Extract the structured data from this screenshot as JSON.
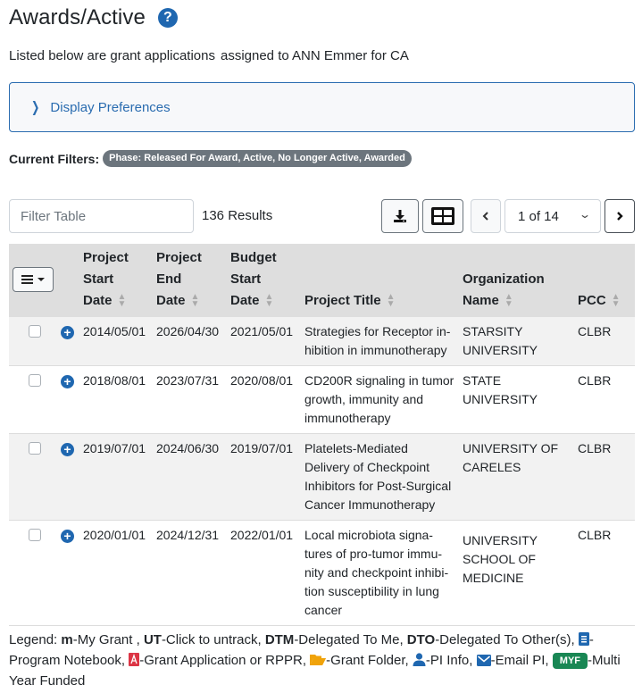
{
  "header": {
    "title": "Awards/Active",
    "help_icon": "question-circle-icon",
    "subtitle_prefix": "Listed below are grant applications",
    "subtitle_suffix": "assigned to ANN Emmer for CA"
  },
  "display_preferences": {
    "label": "Display Preferences",
    "icon": "chevron-right-icon",
    "expanded": false
  },
  "filters": {
    "label": "Current Filters:",
    "badges": [
      "Phase: Released For Award, Active, No Longer Active, Awarded"
    ]
  },
  "toolbar": {
    "filter_placeholder": "Filter Table",
    "filter_value": "",
    "results_count": "136 Results",
    "download_icon": "download-icon",
    "columns_icon": "table-columns-icon",
    "prev_icon": "chevron-left-icon",
    "next_icon": "chevron-right-icon",
    "page_select": "1 of 14"
  },
  "table": {
    "menu_icon": "hamburger-menu-icon",
    "columns": [
      {
        "key": "start",
        "label_lines": [
          "Project",
          "Start",
          "Date"
        ],
        "sortable": true
      },
      {
        "key": "end",
        "label_lines": [
          "Project",
          "End",
          "Date"
        ],
        "sortable": true
      },
      {
        "key": "budget",
        "label_lines": [
          "Budget",
          "Start",
          "Date"
        ],
        "sortable": true
      },
      {
        "key": "title",
        "label_lines": [
          "Project Title"
        ],
        "sortable": true
      },
      {
        "key": "org",
        "label_lines": [
          "Organization",
          "Name"
        ],
        "sortable": true
      },
      {
        "key": "pcc",
        "label_lines": [
          "PCC"
        ],
        "sortable": true
      }
    ],
    "rows": [
      {
        "checked": false,
        "start": "2014/05/01",
        "end": "2026/04/30",
        "budget": "2021/05/01",
        "title": "Strategies for Receptor in­hibition in immunotherapy",
        "org": "STARSITY UNIVERSITY",
        "pcc": "CLBR"
      },
      {
        "checked": false,
        "start": "2018/08/01",
        "end": "2023/07/31",
        "budget": "2020/08/01",
        "title": "CD200R signaling in tumor growth, immunity and immunotherapy",
        "org": "STATE UNIVERSITY",
        "pcc": "CLBR"
      },
      {
        "checked": false,
        "start": "2019/07/01",
        "end": "2024/06/30",
        "budget": "2019/07/01",
        "title": "Platelets-Mediated Delivery of Checkpoint Inhibitors for Post-Surgical Cancer Immunotherapy",
        "org": "UNIVERSITY OF CARELES",
        "pcc": "CLBR"
      },
      {
        "checked": false,
        "start": "2020/01/01",
        "end": "2024/12/31",
        "budget": "2022/01/01",
        "title": "Local microbiota signa­tures of pro-tumor immu­nity and checkpoint inhibi­tion susceptibility in lung cancer",
        "org": "UNIVERSITY SCHOOL OF MEDICINE",
        "pcc": "CLBR"
      }
    ]
  },
  "legend": {
    "prefix": "Legend:",
    "items": [
      {
        "code": "m",
        "text": "-My Grant ,"
      },
      {
        "code": "UT",
        "text": "-Click to untrack,"
      },
      {
        "code": "DTM",
        "text": "-Delegated To Me,"
      },
      {
        "code": "DTO",
        "text": "-Delegated To Other(s),"
      }
    ],
    "icon_items": [
      {
        "icon": "notebook-icon",
        "text": "-Program Notebook,",
        "color": "#1f67b0"
      },
      {
        "icon": "pdf-icon",
        "text": "-Grant Application or RPPR,",
        "color": "#dc3545"
      },
      {
        "icon": "folder-open-icon",
        "text": "-Grant Folder,",
        "color": "#f0a30a"
      },
      {
        "icon": "user-icon",
        "text": "-PI Info,",
        "color": "#1f67b0"
      },
      {
        "icon": "envelope-icon",
        "text": "-Email PI,",
        "color": "#1f67b0"
      }
    ],
    "myf_badge": "MYF",
    "myf_text": "-Multi Year Funded"
  },
  "colors": {
    "primary": "#1f67b0",
    "header_bg": "#dedede",
    "badge_gray": "#6c757d",
    "myf_green": "#198754"
  }
}
